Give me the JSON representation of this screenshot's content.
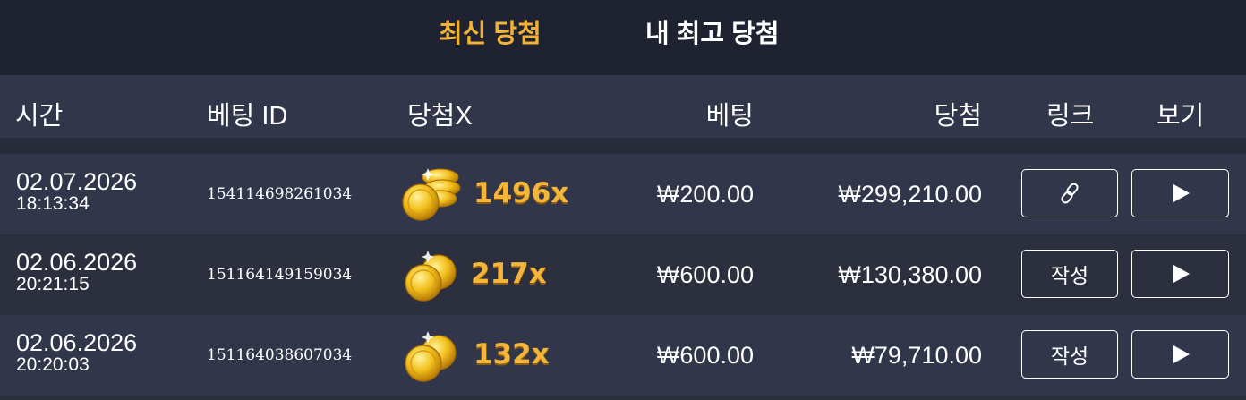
{
  "tabs": {
    "latest": "최신 당첨",
    "my_best": "내 최고 당첨"
  },
  "header": {
    "time": "시간",
    "bet_id": "베팅 ID",
    "multiplier": "당첨X",
    "bet": "베팅",
    "win": "당첨",
    "link": "링크",
    "view": "보기"
  },
  "colors": {
    "accent": "#f1b238",
    "topbar_bg": "#1f2230",
    "header_bg": "#32364a",
    "row_bg_a": "#32364a",
    "row_bg_b": "#2c2f3e"
  },
  "rows": [
    {
      "date": "02.07.2026",
      "time": "18:13:34",
      "bet_id": "154114698261034",
      "coin_icon": "coin-stack-icon",
      "multiplier": "1496x",
      "bet": "₩200.00",
      "win": "₩299,210.00",
      "link_icon": "link-icon",
      "link_label": "",
      "view_icon": "play-icon"
    },
    {
      "date": "02.06.2026",
      "time": "20:21:15",
      "bet_id": "151164149159034",
      "coin_icon": "coin-pair-icon",
      "multiplier": "217x",
      "bet": "₩600.00",
      "win": "₩130,380.00",
      "link_icon": "",
      "link_label": "작성",
      "view_icon": "play-icon"
    },
    {
      "date": "02.06.2026",
      "time": "20:20:03",
      "bet_id": "151164038607034",
      "coin_icon": "coin-pair-icon",
      "multiplier": "132x",
      "bet": "₩600.00",
      "win": "₩79,710.00",
      "link_icon": "",
      "link_label": "작성",
      "view_icon": "play-icon"
    }
  ]
}
